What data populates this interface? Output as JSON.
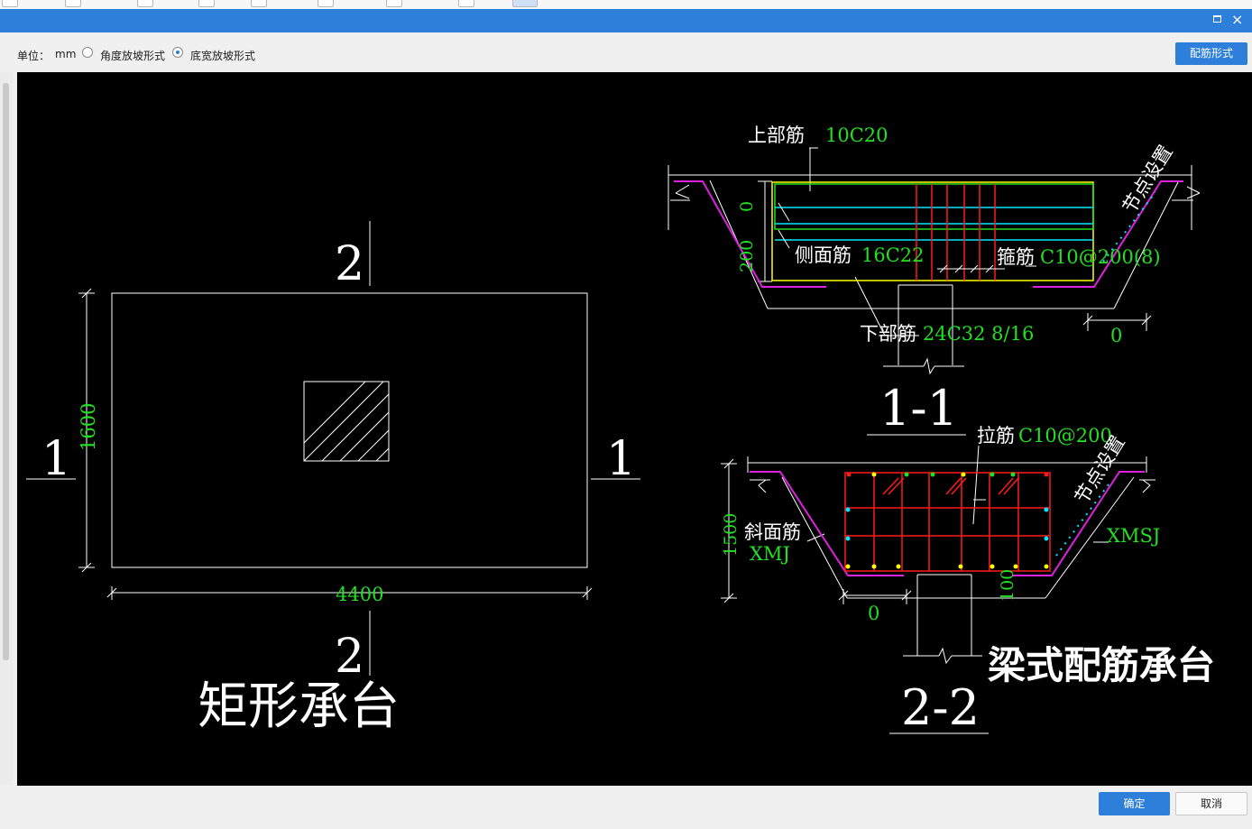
{
  "toolbar_icons": [
    "toolbar-icon-1",
    "toolbar-icon-2",
    "toolbar-icon-3",
    "toolbar-icon-4",
    "toolbar-icon-5",
    "toolbar-icon-6",
    "toolbar-icon-7",
    "toolbar-icon-8",
    "toolbar-icon-9"
  ],
  "titlebar": {
    "maximize_icon": "maximize-icon",
    "close_label": "×"
  },
  "options": {
    "unit_label": "单位：",
    "unit_value": "mm",
    "radio_angle_label": "角度放坡形式",
    "radio_width_label": "底宽放坡形式",
    "selected": "底宽放坡形式",
    "reinforce_button": "配筋形式"
  },
  "drawing": {
    "plan": {
      "section_top": "2",
      "section_bottom": "2",
      "section_left": "1",
      "section_right": "1",
      "dim_height": "1600",
      "dim_width": "4400",
      "title": "矩形承台"
    },
    "section11": {
      "top_bar_label": "上部筋",
      "top_bar_value": "10C20",
      "side_bar_label": "侧面筋",
      "side_bar_value": "16C22",
      "stirrup_label": "箍筋",
      "stirrup_value": "C10@200(8)",
      "bottom_bar_label": "下部筋",
      "bottom_bar_value": "24C32 8/16",
      "dim_zero_left": "0",
      "dim_200": "200",
      "dim_zero_right": "0",
      "node_label": "节点设置",
      "title": "1-1"
    },
    "section22": {
      "tie_label": "拉筋",
      "tie_value": "C10@200",
      "node_label": "节点设置",
      "slope_label": "斜面筋",
      "slope_value": "XMJ",
      "slope_right_value": "XMSJ",
      "dim_1500": "1500",
      "dim_100": "100",
      "dim_zero": "0",
      "title": "2-2",
      "type_title": "梁式配筋承台"
    },
    "colors": {
      "green": "#22e022",
      "yellow": "#ffff00",
      "cyan": "#00e8ff",
      "red": "#ff1a1a",
      "magenta": "#e020e0",
      "white": "#ffffff"
    }
  },
  "footer": {
    "ok_label": "确定",
    "cancel_label": "取消"
  }
}
